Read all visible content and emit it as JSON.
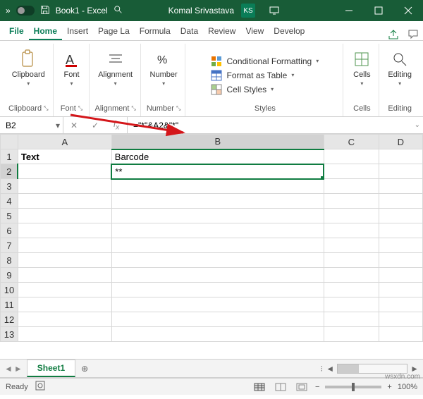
{
  "titlebar": {
    "doc": "Book1  - Excel",
    "search_placeholder": "Search",
    "user_name": "Komal Srivastava",
    "user_initials": "KS"
  },
  "tabs": {
    "file": "File",
    "items": [
      "Home",
      "Insert",
      "Page La",
      "Formula",
      "Data",
      "Review",
      "View",
      "Develop"
    ],
    "active": "Home"
  },
  "ribbon": {
    "clipboard": {
      "label": "Clipboard",
      "btn": "Clipboard"
    },
    "font": {
      "label": "Font",
      "btn": "Font"
    },
    "alignment": {
      "label": "Alignment",
      "btn": "Alignment"
    },
    "number": {
      "label": "Number",
      "btn": "Number"
    },
    "styles": {
      "label": "Styles",
      "cond": "Conditional Formatting",
      "table": "Format as Table",
      "cell": "Cell Styles"
    },
    "cells": {
      "label": "Cells",
      "btn": "Cells"
    },
    "editing": {
      "label": "Editing",
      "btn": "Editing"
    }
  },
  "namebox": "B2",
  "formula": "=\"*\"&A2&\"*\"",
  "columns": [
    "A",
    "B",
    "C",
    "D"
  ],
  "rows": [
    1,
    2,
    3,
    4,
    5,
    6,
    7,
    8,
    9,
    10,
    11,
    12,
    13
  ],
  "cells": {
    "A1": "Text",
    "B1": "Barcode",
    "B2": "**"
  },
  "sheettab": "Sheet1",
  "status": {
    "ready": "Ready",
    "zoom": "100%"
  },
  "watermark": "wsxdn.com"
}
